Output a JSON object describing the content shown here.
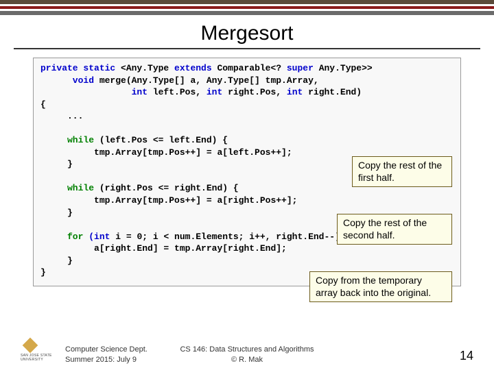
{
  "title": "Mergesort",
  "code": {
    "l1a": "private",
    "l1b": " static",
    "l1c": " <Any.Type ",
    "l1d": "extends",
    "l1e": " Comparable<? ",
    "l1f": "super",
    "l1g": " Any.Type>>",
    "l2a": "      void",
    "l2b": " merge(Any.Type[] a, Any.Type[] tmp.Array,",
    "l3a": "                 int",
    "l3b": " left.Pos, ",
    "l3c": "int",
    "l3d": " right.Pos, ",
    "l3e": "int",
    "l3f": " right.End)",
    "l4": "{",
    "l5": "     ...",
    "blank1": "",
    "l6a": "     while",
    "l6b": " (left.Pos <= left.End) {",
    "l7": "          tmp.Array[tmp.Pos++] = a[left.Pos++];",
    "l8": "     }",
    "blank2": "",
    "l9a": "     while",
    "l9b": " (right.Pos <= right.End) {",
    "l10": "          tmp.Array[tmp.Pos++] = a[right.Pos++];",
    "l11": "     }",
    "blank3": "",
    "l12a": "     for",
    "l12b": " (int",
    "l12c": " i = 0; i < num.Elements; i++, right.End--) {",
    "l13": "          a[right.End] = tmp.Array[right.End];",
    "l14": "     }",
    "l15": "}"
  },
  "annotations": {
    "a1": "Copy the rest of the first half.",
    "a2": "Copy the rest of the second half.",
    "a3": "Copy from the temporary array back into the original."
  },
  "footer": {
    "dept": "Computer Science Dept.",
    "term": "Summer 2015: July 9",
    "course": "CS 146: Data Structures and Algorithms",
    "author": "© R. Mak",
    "page": "14",
    "university": "SAN JOSE STATE UNIVERSITY"
  }
}
